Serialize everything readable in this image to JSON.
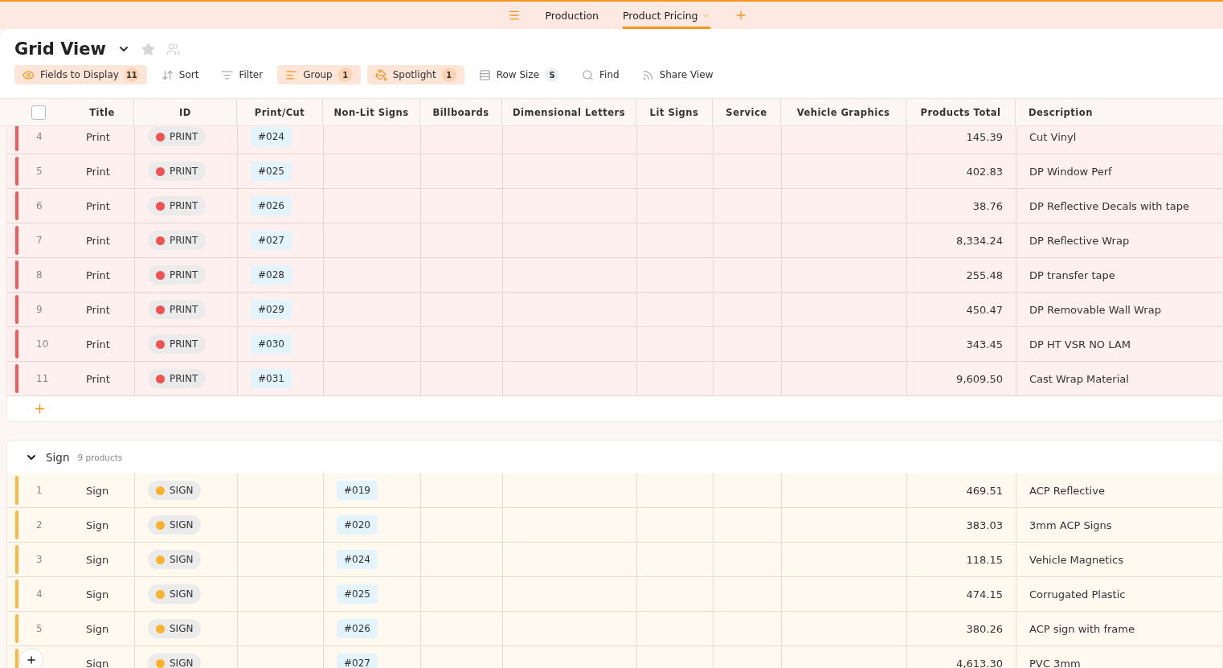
{
  "top_tabs": [
    {
      "label": "Production",
      "selected": false
    },
    {
      "label": "Product Pricing",
      "selected": true
    }
  ],
  "view": {
    "title": "Grid View",
    "starred": false
  },
  "toolbar": [
    {
      "label": "Fields to Display",
      "count": "11",
      "active": true
    },
    {
      "label": "Sort",
      "active": false
    },
    {
      "label": "Filter",
      "active": false
    },
    {
      "label": "Group",
      "count": "1",
      "active": true
    },
    {
      "label": "Spotlight",
      "count": "1",
      "active": true
    },
    {
      "label": "Row Size",
      "count": "S",
      "active": false
    },
    {
      "label": "Find",
      "active": false
    },
    {
      "label": "Share View",
      "active": false
    }
  ],
  "table": {
    "select_all_checked": false,
    "columns": [
      "Title",
      "ID",
      "Print/Cut",
      "Non-Lit Signs",
      "Billboards",
      "Dimensional Letters",
      "Lit Signs",
      "Service",
      "Vehicle Graphics",
      "Products Total",
      "Description"
    ],
    "groups": [
      {
        "color": "#f05a5a",
        "rows": [
          {
            "number": "4",
            "title": "Print",
            "status": {
              "label": "PRINT",
              "color": "#f25252"
            },
            "print_cut": "#024",
            "total": "145.39",
            "description": "Cut Vinyl"
          },
          {
            "number": "5",
            "title": "Print",
            "status": {
              "label": "PRINT",
              "color": "#f25252"
            },
            "print_cut": "#025",
            "total": "402.83",
            "description": "DP Window Perf"
          },
          {
            "number": "6",
            "title": "Print",
            "status": {
              "label": "PRINT",
              "color": "#f25252"
            },
            "print_cut": "#026",
            "total": "38.76",
            "description": "DP Reflective Decals with tape"
          },
          {
            "number": "7",
            "title": "Print",
            "status": {
              "label": "PRINT",
              "color": "#f25252"
            },
            "print_cut": "#027",
            "total": "8,334.24",
            "description": "DP Reflective Wrap"
          },
          {
            "number": "8",
            "title": "Print",
            "status": {
              "label": "PRINT",
              "color": "#f25252"
            },
            "print_cut": "#028",
            "total": "255.48",
            "description": "DP transfer tape"
          },
          {
            "number": "9",
            "title": "Print",
            "status": {
              "label": "PRINT",
              "color": "#f25252"
            },
            "print_cut": "#029",
            "total": "450.47",
            "description": "DP Removable Wall Wrap"
          },
          {
            "number": "10",
            "title": "Print",
            "status": {
              "label": "PRINT",
              "color": "#f25252"
            },
            "print_cut": "#030",
            "total": "343.45",
            "description": "DP HT VSR NO LAM"
          },
          {
            "number": "11",
            "title": "Print",
            "status": {
              "label": "PRINT",
              "color": "#f25252"
            },
            "print_cut": "#031",
            "total": "9,609.50",
            "description": "Cast Wrap Material"
          }
        ]
      },
      {
        "name": "Sign",
        "count": "9 products",
        "expanded": true,
        "color": "#f7b940",
        "rows": [
          {
            "number": "1",
            "title": "Sign",
            "status": {
              "label": "SIGN",
              "color": "#fbb22c"
            },
            "non_lit_signs": "#019",
            "total": "469.51",
            "description": "ACP Reflective"
          },
          {
            "number": "2",
            "title": "Sign",
            "status": {
              "label": "SIGN",
              "color": "#fbb22c"
            },
            "non_lit_signs": "#020",
            "total": "383.03",
            "description": "3mm ACP Signs"
          },
          {
            "number": "3",
            "title": "Sign",
            "status": {
              "label": "SIGN",
              "color": "#fbb22c"
            },
            "non_lit_signs": "#024",
            "total": "118.15",
            "description": "Vehicle Magnetics"
          },
          {
            "number": "4",
            "title": "Sign",
            "status": {
              "label": "SIGN",
              "color": "#fbb22c"
            },
            "non_lit_signs": "#025",
            "total": "474.15",
            "description": "Corrugated Plastic"
          },
          {
            "number": "5",
            "title": "Sign",
            "status": {
              "label": "SIGN",
              "color": "#fbb22c"
            },
            "non_lit_signs": "#026",
            "total": "380.26",
            "description": "ACP sign with frame"
          },
          {
            "title": "Sign",
            "status": {
              "label": "SIGN",
              "color": "#fbb22c"
            },
            "non_lit_signs": "#027",
            "total": "4,613.30",
            "description": "PVC 3mm"
          }
        ]
      }
    ]
  }
}
